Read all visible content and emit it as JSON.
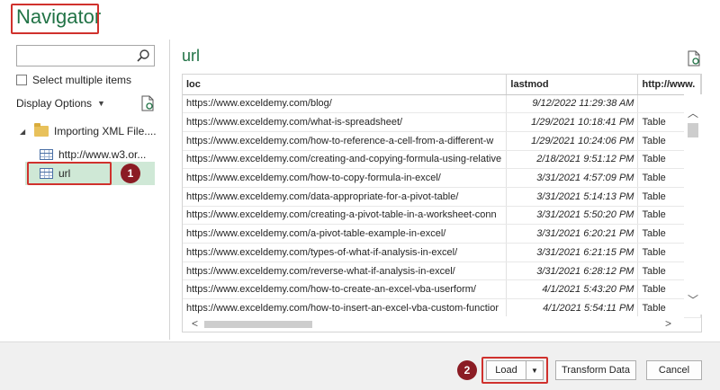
{
  "window": {
    "title": "Navigator"
  },
  "left": {
    "search_placeholder": "",
    "select_multiple": "Select multiple items",
    "display_options": "Display Options",
    "tree": {
      "folder": "Importing XML File....",
      "child1": "http://www.w3.or...",
      "child2": "url"
    },
    "badge": "1"
  },
  "preview": {
    "title": "url",
    "columns": [
      "loc",
      "lastmod",
      "http://www."
    ],
    "rows": [
      [
        "https://www.exceldemy.com/blog/",
        "9/12/2022 11:29:38 AM",
        ""
      ],
      [
        "https://www.exceldemy.com/what-is-spreadsheet/",
        "1/29/2021 10:18:41 PM",
        "Table"
      ],
      [
        "https://www.exceldemy.com/how-to-reference-a-cell-from-a-different-w",
        "1/29/2021 10:24:06 PM",
        "Table"
      ],
      [
        "https://www.exceldemy.com/creating-and-copying-formula-using-relative",
        "2/18/2021 9:51:12 PM",
        "Table"
      ],
      [
        "https://www.exceldemy.com/how-to-copy-formula-in-excel/",
        "3/31/2021 4:57:09 PM",
        "Table"
      ],
      [
        "https://www.exceldemy.com/data-appropriate-for-a-pivot-table/",
        "3/31/2021 5:14:13 PM",
        "Table"
      ],
      [
        "https://www.exceldemy.com/creating-a-pivot-table-in-a-worksheet-conn",
        "3/31/2021 5:50:20 PM",
        "Table"
      ],
      [
        "https://www.exceldemy.com/a-pivot-table-example-in-excel/",
        "3/31/2021 6:20:21 PM",
        "Table"
      ],
      [
        "https://www.exceldemy.com/types-of-what-if-analysis-in-excel/",
        "3/31/2021 6:21:15 PM",
        "Table"
      ],
      [
        "https://www.exceldemy.com/reverse-what-if-analysis-in-excel/",
        "3/31/2021 6:28:12 PM",
        "Table"
      ],
      [
        "https://www.exceldemy.com/how-to-create-an-excel-vba-userform/",
        "4/1/2021 5:43:20 PM",
        "Table"
      ],
      [
        "https://www.exceldemy.com/how-to-insert-an-excel-vba-custom-functior",
        "4/1/2021 5:54:11 PM",
        "Table"
      ]
    ]
  },
  "footer": {
    "load": "Load",
    "transform": "Transform Data",
    "cancel": "Cancel",
    "badge": "2"
  },
  "colors": {
    "accent": "#217346",
    "highlight": "#d0312d",
    "badge": "#8b1c24",
    "selected": "#cfe8d6"
  }
}
